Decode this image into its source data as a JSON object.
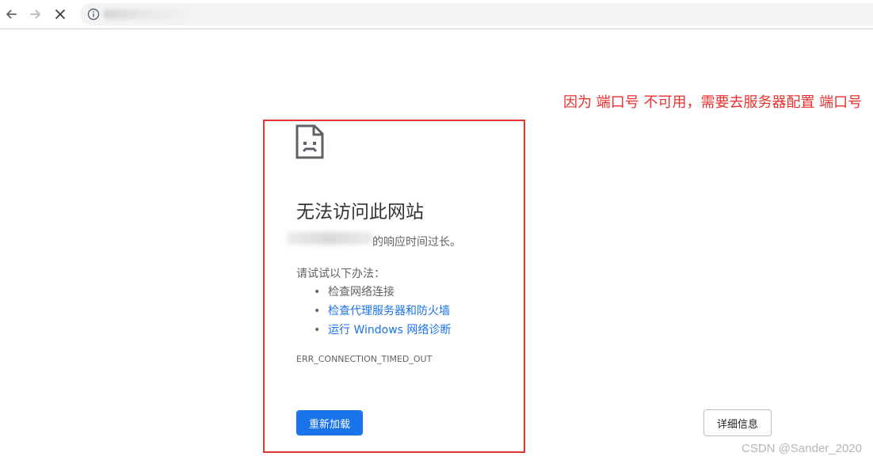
{
  "annotation": {
    "text": "因为 端口号 不可用，需要去服务器配置 端口号",
    "color": "#e8302f"
  },
  "error_page": {
    "title": "无法访问此网站",
    "description": "的响应时间过长。",
    "try_heading": "请试试以下办法：",
    "suggestions": [
      {
        "label": "检查网络连接",
        "link": false
      },
      {
        "label": "检查代理服务器和防火墙",
        "link": true
      },
      {
        "label": "运行 Windows 网络诊断",
        "link": true
      }
    ],
    "error_code": "ERR_CONNECTION_TIMED_OUT",
    "reload_label": "重新加载",
    "details_label": "详细信息"
  },
  "watermark": "CSDN @Sander_2020",
  "colors": {
    "accent": "#1a73e8",
    "annotation_red": "#e0352f"
  }
}
